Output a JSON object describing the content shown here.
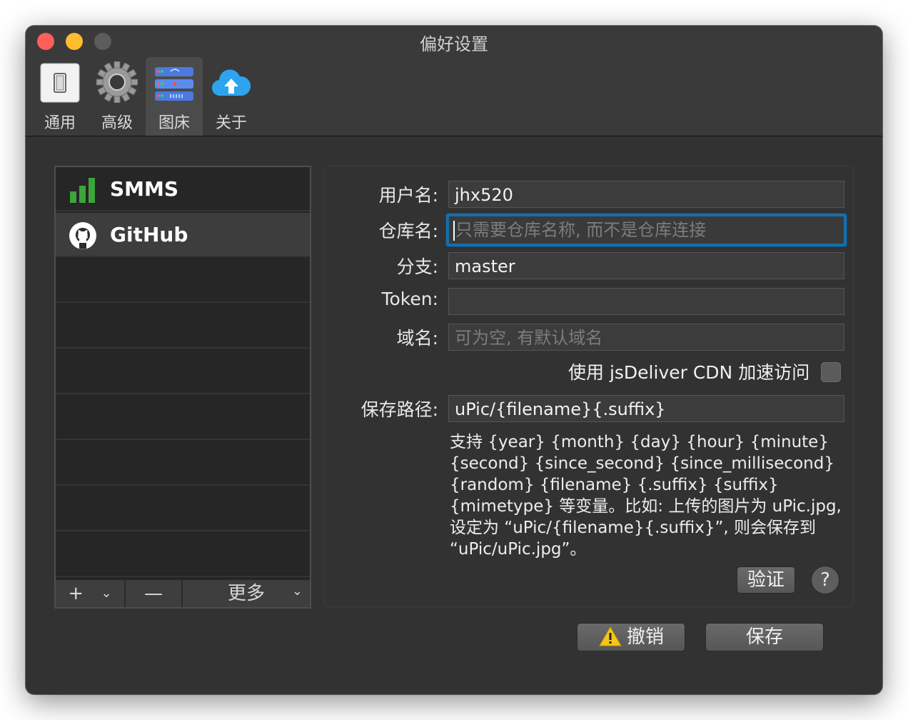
{
  "window": {
    "title": "偏好设置"
  },
  "toolbar": {
    "items": [
      {
        "label": "通用",
        "icon": "switch-icon"
      },
      {
        "label": "高级",
        "icon": "gear-icon"
      },
      {
        "label": "图床",
        "icon": "server-icon",
        "selected": true
      },
      {
        "label": "关于",
        "icon": "cloud-upload-icon"
      }
    ]
  },
  "sidebar": {
    "items": [
      {
        "label": "SMMS",
        "icon": "signal-bars-icon"
      },
      {
        "label": "GitHub",
        "icon": "github-icon",
        "selected": true
      }
    ],
    "add_label": "+",
    "remove_label": "—",
    "more_label": "更多"
  },
  "form": {
    "username_label": "用户名:",
    "username_value": "jhx520",
    "repo_label": "仓库名:",
    "repo_placeholder": "只需要仓库名称, 而不是仓库连接",
    "branch_label": "分支:",
    "branch_value": "master",
    "token_label": "Token:",
    "token_value": "",
    "domain_label": "域名:",
    "domain_placeholder": "可为空, 有默认域名",
    "cdn_label": "使用 jsDeliver CDN 加速访问",
    "cdn_checked": false,
    "path_label": "保存路径:",
    "path_value": "uPic/{filename}{.suffix}",
    "help_text": "支持 {year} {month} {day} {hour} {minute} {second} {since_second} {since_millisecond} {random} {filename} {.suffix} {suffix} {mimetype} 等变量。比如: 上传的图片为 uPic.jpg, 设定为 “uPic/{filename}{.suffix}”, 则会保存到 “uPic/uPic.jpg”。",
    "verify_label": "验证",
    "help_label": "?"
  },
  "footer": {
    "cancel_label": "撤销",
    "save_label": "保存"
  },
  "colors": {
    "focus_ring": "#1a6ea8",
    "close": "#fe5f57",
    "minimize": "#febc2e",
    "warning": "#f5c518"
  }
}
